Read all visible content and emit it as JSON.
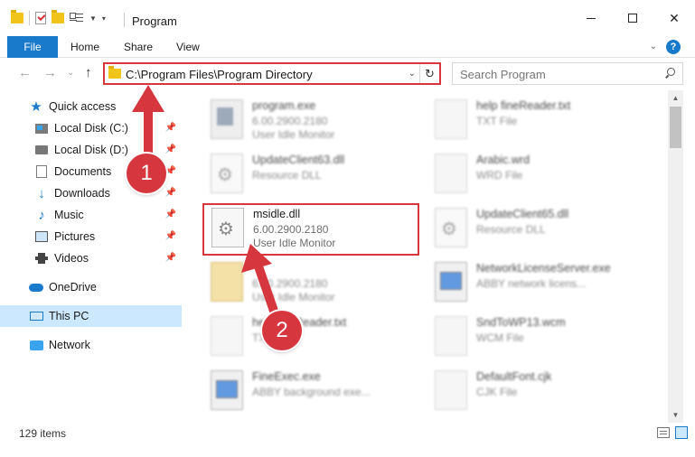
{
  "window": {
    "title": "Program",
    "minimize": "—",
    "close": "✕"
  },
  "ribbon": {
    "tabs": [
      "File",
      "Home",
      "Share",
      "View"
    ],
    "help": "?"
  },
  "nav": {
    "back": "←",
    "forward": "→",
    "recent": "⌄",
    "up": "↑",
    "address": "C:\\Program Files\\Program Directory",
    "refresh": "↻",
    "search_placeholder": "Search Program"
  },
  "sidebar": {
    "items": [
      {
        "label": "Quick access",
        "icon": "star-icon"
      },
      {
        "label": "Local Disk (C:)",
        "icon": "drive-c-icon",
        "pinned": true
      },
      {
        "label": "Local Disk (D:)",
        "icon": "drive-icon",
        "pinned": true
      },
      {
        "label": "Documents",
        "icon": "documents-icon",
        "pinned": true
      },
      {
        "label": "Downloads",
        "icon": "download-icon",
        "pinned": true
      },
      {
        "label": "Music",
        "icon": "music-icon",
        "pinned": true
      },
      {
        "label": "Pictures",
        "icon": "pictures-icon",
        "pinned": true
      },
      {
        "label": "Videos",
        "icon": "videos-icon",
        "pinned": true
      },
      {
        "label": "OneDrive",
        "icon": "cloud-icon"
      },
      {
        "label": "This PC",
        "icon": "computer-icon",
        "selected": true
      },
      {
        "label": "Network",
        "icon": "network-icon"
      }
    ]
  },
  "files": [
    {
      "name": "program.exe",
      "line1": "6.00.2900.2180",
      "line2": "User Idle Monitor",
      "icon": "program-icon"
    },
    {
      "name": "help fineReader.txt",
      "line1": "TXT File",
      "line2": "",
      "icon": "text-file-icon"
    },
    {
      "name": "UpdateClient63.dll",
      "line1": "Resource DLL",
      "line2": "",
      "icon": "dll-icon"
    },
    {
      "name": "Arabic.wrd",
      "line1": "WRD File",
      "line2": "",
      "icon": "file-icon"
    },
    {
      "name": "msidle.dll",
      "line1": "6.00.2900.2180",
      "line2": "User Idle Monitor",
      "icon": "dll-icon"
    },
    {
      "name": "UpdateClient65.dll",
      "line1": "Resource DLL",
      "line2": "",
      "icon": "dll-icon"
    },
    {
      "name": "",
      "line1": "6.00.2900.2180",
      "line2": "User Idle Monitor",
      "icon": "file-icon"
    },
    {
      "name": "NetworkLicenseServer.exe",
      "line1": "ABBY network licens...",
      "line2": "",
      "icon": "exe-icon"
    },
    {
      "name": "help fineReader.txt",
      "line1": "TXT",
      "line2": "",
      "icon": "text-file-icon"
    },
    {
      "name": "SndToWP13.wcm",
      "line1": "WCM File",
      "line2": "",
      "icon": "file-icon"
    },
    {
      "name": "FineExec.exe",
      "line1": "ABBY background exe...",
      "line2": "",
      "icon": "exe-icon"
    },
    {
      "name": "DefaultFont.cjk",
      "line1": "CJK File",
      "line2": "",
      "icon": "file-icon"
    }
  ],
  "status": {
    "count": "129 items"
  },
  "callouts": [
    "1",
    "2"
  ],
  "colors": {
    "accent": "#1979ca",
    "highlight": "#d9363e",
    "selection": "#cce8ff"
  }
}
